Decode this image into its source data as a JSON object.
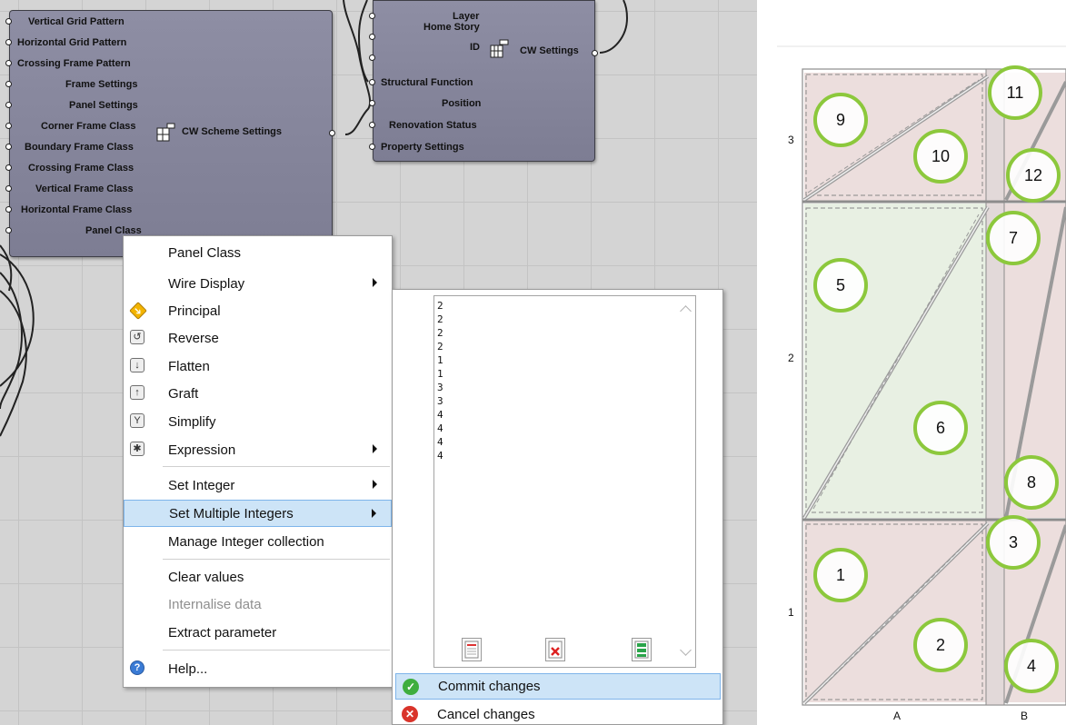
{
  "scheme_node": {
    "inputs": [
      "Vertical Grid Pattern",
      "Horizontal Grid Pattern",
      "Crossing Frame Pattern",
      "Frame Settings",
      "Panel Settings",
      "Corner Frame Class",
      "Boundary Frame Class",
      "Crossing Frame Class",
      "Vertical Frame Class",
      "Horizontal Frame Class",
      "Panel Class"
    ],
    "output": "CW Scheme Settings"
  },
  "settings_node": {
    "inputs": [
      "Layer",
      "Home Story",
      "ID",
      "Structural Function",
      "Position",
      "Renovation Status",
      "Property Settings"
    ],
    "output": "CW Settings"
  },
  "context_menu": {
    "title": "Panel Class",
    "items": [
      {
        "label": "Wire Display"
      },
      {
        "label": "Principal",
        "icon": "principal-icon"
      },
      {
        "label": "Reverse",
        "icon": "reverse-icon"
      },
      {
        "label": "Flatten",
        "icon": "flatten-icon"
      },
      {
        "label": "Graft",
        "icon": "graft-icon"
      },
      {
        "label": "Simplify",
        "icon": "simplify-icon"
      },
      {
        "label": "Expression",
        "icon": "expression-icon"
      },
      {
        "label": "Set Integer"
      },
      {
        "label": "Set Multiple Integers"
      },
      {
        "label": "Manage Integer collection"
      },
      {
        "label": "Clear values"
      },
      {
        "label": "Internalise data"
      },
      {
        "label": "Extract parameter"
      },
      {
        "label": "Help...",
        "icon": "help-icon"
      }
    ]
  },
  "integer_editor": {
    "values": [
      "2",
      "2",
      "2",
      "2",
      "1",
      "1",
      "3",
      "3",
      "4",
      "4",
      "4",
      "4"
    ],
    "commit_label": "Commit changes",
    "cancel_label": "Cancel changes"
  },
  "diagram": {
    "panels": [
      "1",
      "2",
      "3",
      "4",
      "5",
      "6",
      "7",
      "8",
      "9",
      "10",
      "11",
      "12"
    ],
    "row_labels": [
      "1",
      "2",
      "3"
    ],
    "column_labels": [
      "A",
      "B"
    ],
    "circle_color": "#8cc83c"
  },
  "colors": {
    "node_fill": "#8585a0",
    "highlight": "#cde4f7",
    "canvas": "#d4d4d4"
  }
}
